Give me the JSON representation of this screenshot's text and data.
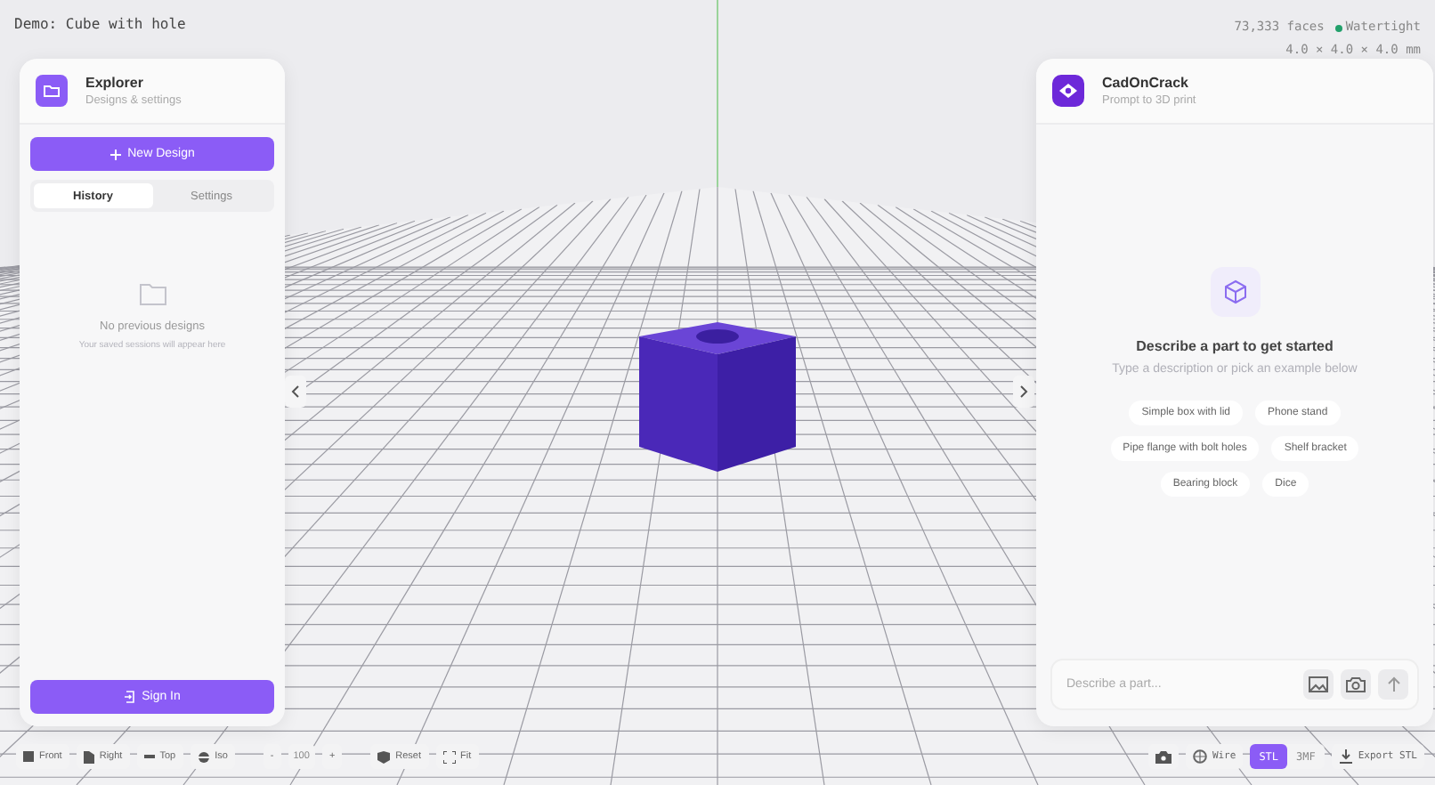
{
  "demo_label": "Demo: Cube with hole",
  "stats": {
    "faces": "73,333 faces",
    "status": {
      "label": "Watertight",
      "color": "#22a06b"
    },
    "dimensions": "4.0 × 4.0 × 4.0 mm"
  },
  "explorer": {
    "title": "Explorer",
    "subtitle": "Designs & settings",
    "new_button": "New Design",
    "tabs": [
      {
        "label": "History",
        "selected": true
      },
      {
        "label": "Settings",
        "selected": false
      }
    ],
    "empty_title": "No previous designs",
    "empty_subtitle": "Your saved sessions will appear here",
    "sign_in": "Sign In"
  },
  "assistant": {
    "title": "CadOnCrack",
    "subtitle": "Prompt to 3D print",
    "heading": "Describe a part to get started",
    "subheading": "Type a description or pick an example below",
    "examples": [
      "Simple box with lid",
      "Phone stand",
      "Pipe flange with bolt holes",
      "Shelf bracket",
      "Bearing block",
      "Dice"
    ],
    "input": {
      "placeholder": "Describe a part..."
    }
  },
  "view_toolbar": {
    "views": [
      {
        "label": "Front",
        "kind": "front"
      },
      {
        "label": "Right",
        "kind": "right"
      },
      {
        "label": "Top",
        "kind": "top"
      },
      {
        "label": "Iso",
        "kind": "iso"
      }
    ],
    "zoom_out": "-",
    "zoom": "100",
    "zoom_in": "+",
    "reset": "Reset",
    "fit": "Fit"
  },
  "export_toolbar": {
    "wire": "Wire",
    "formats": [
      {
        "label": "STL",
        "selected": true
      },
      {
        "label": "3MF",
        "selected": false
      }
    ],
    "export": "Export STL"
  }
}
